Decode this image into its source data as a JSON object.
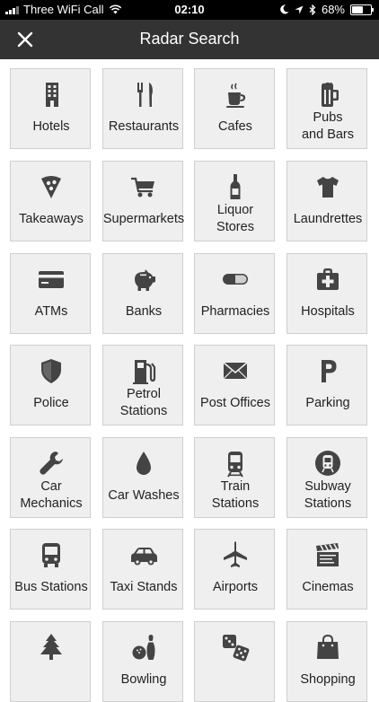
{
  "status": {
    "carrier": "Three WiFi Call",
    "time": "02:10",
    "battery": "68%",
    "battery_level": 0.68
  },
  "nav": {
    "title": "Radar Search"
  },
  "categories": [
    {
      "label": "Hotels",
      "icon": "building-icon"
    },
    {
      "label": "Restaurants",
      "icon": "cutlery-icon"
    },
    {
      "label": "Cafes",
      "icon": "coffee-cup-icon"
    },
    {
      "label": "Pubs\nand Bars",
      "icon": "beer-mug-icon"
    },
    {
      "label": "Takeaways",
      "icon": "pizza-slice-icon"
    },
    {
      "label": "Supermarkets",
      "icon": "shopping-cart-icon"
    },
    {
      "label": "Liquor\nStores",
      "icon": "bottle-icon"
    },
    {
      "label": "Laundrettes",
      "icon": "t-shirt-icon"
    },
    {
      "label": "ATMs",
      "icon": "credit-card-icon"
    },
    {
      "label": "Banks",
      "icon": "piggy-bank-icon"
    },
    {
      "label": "Pharmacies",
      "icon": "pill-icon"
    },
    {
      "label": "Hospitals",
      "icon": "medical-kit-icon"
    },
    {
      "label": "Police",
      "icon": "shield-icon"
    },
    {
      "label": "Petrol\nStations",
      "icon": "fuel-pump-icon"
    },
    {
      "label": "Post Offices",
      "icon": "envelope-icon"
    },
    {
      "label": "Parking",
      "icon": "parking-icon"
    },
    {
      "label": "Car\nMechanics",
      "icon": "wrench-icon"
    },
    {
      "label": "Car Washes",
      "icon": "water-drop-icon"
    },
    {
      "label": "Train\nStations",
      "icon": "train-icon"
    },
    {
      "label": "Subway\nStations",
      "icon": "subway-icon"
    },
    {
      "label": "Bus Stations",
      "icon": "bus-icon"
    },
    {
      "label": "Taxi Stands",
      "icon": "car-icon"
    },
    {
      "label": "Airports",
      "icon": "airplane-icon"
    },
    {
      "label": "Cinemas",
      "icon": "clapperboard-icon"
    },
    {
      "label": "",
      "icon": "tree-icon"
    },
    {
      "label": "Bowling",
      "icon": "bowling-icon"
    },
    {
      "label": "",
      "icon": "dice-icon"
    },
    {
      "label": "Shopping",
      "icon": "shopping-bag-icon"
    }
  ]
}
